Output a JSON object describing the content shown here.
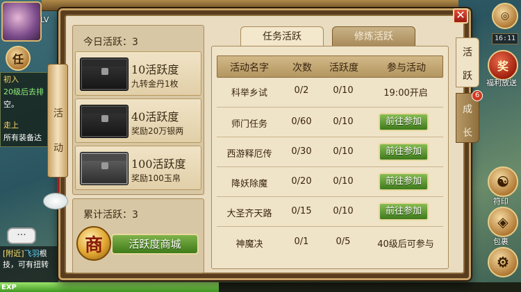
{
  "hud": {
    "level_tag": "LV",
    "task_button": "任",
    "quest_lines": [
      {
        "text": "初入",
        "style": "yellow"
      },
      {
        "text": "20级后去排",
        "style": "green"
      },
      {
        "text": "空。",
        "style": "white"
      },
      {
        "text": "走上",
        "style": "yellow"
      },
      {
        "text": "所有装备达",
        "style": "white"
      }
    ],
    "chat_bubble": "···",
    "chat_channel": "[附近]",
    "chat_name": "飞羽",
    "chat_text": "根",
    "chat_line2": "技，可有扭转",
    "exp_label": "EXP",
    "exp_fraction": 0.42,
    "clock": "16:11",
    "welfare_label": "福利放送",
    "talisman_label": "符印",
    "bag_label": "包裹"
  },
  "dialog": {
    "close_label": "✕",
    "scroll_title_top": "活",
    "scroll_title_bottom": "动",
    "today_label": "今日活跃：3",
    "rewards": [
      {
        "title": "10活跃度",
        "desc": "九转金丹1枚",
        "chest": "dark"
      },
      {
        "title": "40活跃度",
        "desc": "奖励20万银两",
        "chest": "dark"
      },
      {
        "title": "100活跃度",
        "desc": "奖励100玉帛",
        "chest": "silver"
      }
    ],
    "total_label": "累计活跃：3",
    "shop_emblem": "商",
    "shop_button": "活跃度商城",
    "tabs": {
      "active": "任务活跃",
      "inactive": "修炼活跃"
    },
    "side_tabs": {
      "active_top": "活",
      "active_bottom": "跃",
      "inactive_top": "成",
      "inactive_bottom": "长",
      "badge": "6"
    },
    "table": {
      "headers": [
        "活动名字",
        "次数",
        "活跃度",
        "参与活动"
      ],
      "rows": [
        {
          "name": "科举乡试",
          "count": "0/2",
          "activity": "0/10",
          "action": "19:00开启",
          "is_button": false
        },
        {
          "name": "师门任务",
          "count": "0/60",
          "activity": "0/10",
          "action": "前往参加",
          "is_button": true
        },
        {
          "name": "西游释厄传",
          "count": "0/30",
          "activity": "0/10",
          "action": "前往参加",
          "is_button": true
        },
        {
          "name": "降妖除魔",
          "count": "0/20",
          "activity": "0/10",
          "action": "前往参加",
          "is_button": true
        },
        {
          "name": "大圣齐天路",
          "count": "0/15",
          "activity": "0/10",
          "action": "前往参加",
          "is_button": true
        },
        {
          "name": "神魔决",
          "count": "0/1",
          "activity": "0/5",
          "action": "40级后可参与",
          "is_button": false
        }
      ]
    }
  }
}
